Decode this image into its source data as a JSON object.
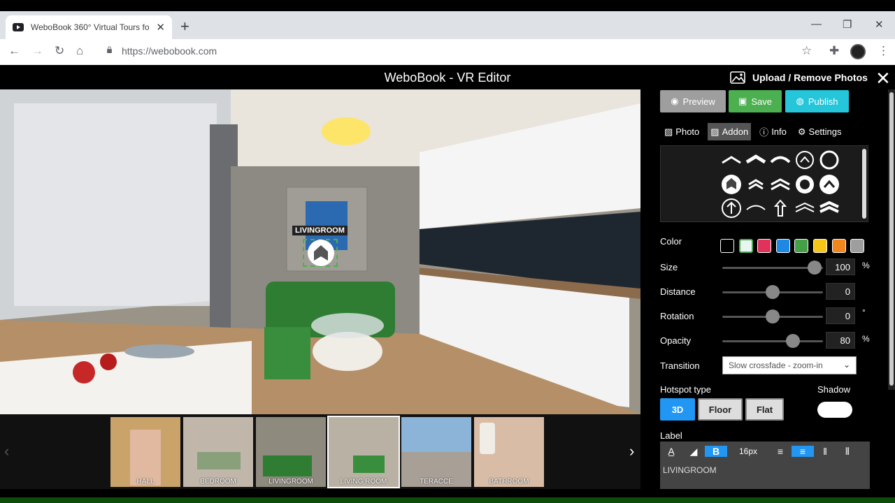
{
  "browser": {
    "tab_title": "WeboBook 360° Virtual Tours fo",
    "url": "https://webobook.com",
    "new_tab": "+",
    "close_tab": "✕"
  },
  "app": {
    "title": "WeboBook - VR Editor",
    "upload_label": "Upload / Remove Photos",
    "close": "✕"
  },
  "hotspot": {
    "label": "LIVINGROOM"
  },
  "actions": {
    "preview": "Preview",
    "save": "Save",
    "publish": "Publish"
  },
  "tabs": [
    {
      "label": "Photo",
      "icon": "image-icon"
    },
    {
      "label": "Addon",
      "icon": "addon-icon"
    },
    {
      "label": "Info",
      "icon": "info-icon"
    },
    {
      "label": "Settings",
      "icon": "gear-icon"
    }
  ],
  "properties": {
    "color_label": "Color",
    "colors": [
      "#000000",
      "#e8f5f0",
      "#e0325a",
      "#1e88e5",
      "#43a047",
      "#f5c518",
      "#f0861e",
      "#9e9e9e"
    ],
    "size": {
      "label": "Size",
      "value": "100",
      "unit": "%",
      "level": 0.92
    },
    "distance": {
      "label": "Distance",
      "value": "0",
      "unit": "",
      "level": 0.5
    },
    "rotation": {
      "label": "Rotation",
      "value": "0",
      "unit": "°",
      "level": 0.5
    },
    "opacity": {
      "label": "Opacity",
      "value": "80",
      "unit": "%",
      "level": 0.7
    },
    "transition": {
      "label": "Transition",
      "value": "Slow crossfade - zoom-in"
    },
    "hotspot_type_label": "Hotspot type",
    "hotspot_types": [
      "3D",
      "Floor",
      "Flat"
    ],
    "shadow_label": "Shadow",
    "label_label": "Label",
    "font_size": "16px",
    "label_text": "LIVINGROOM"
  },
  "thumbnails": [
    {
      "label": "HALL"
    },
    {
      "label": "BEDROOM"
    },
    {
      "label": "LIVINGROOM"
    },
    {
      "label": "LIVING ROOM"
    },
    {
      "label": "TERACCE"
    },
    {
      "label": "BATHROOM"
    }
  ]
}
